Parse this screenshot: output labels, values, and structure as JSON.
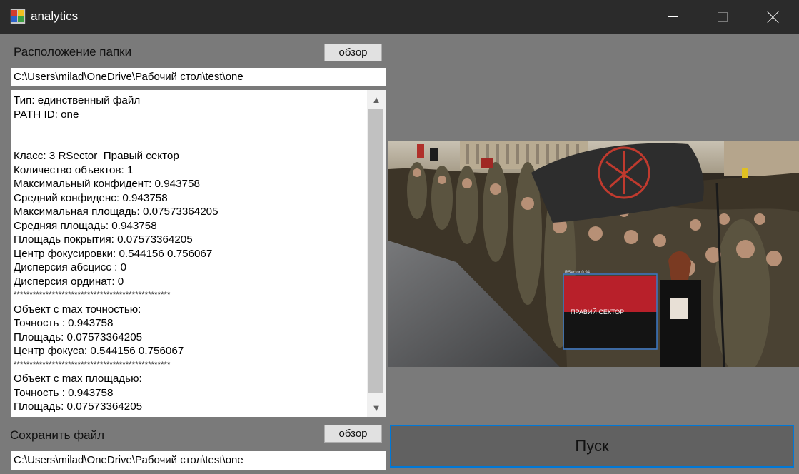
{
  "window": {
    "title": "analytics",
    "icon": "app-icon"
  },
  "controls": {
    "minimize": "minimize-icon",
    "maximize": "maximize-icon",
    "close": "close-icon"
  },
  "folder": {
    "label": "Расположение папки",
    "browse_label": "обзор",
    "path": "C:\\Users\\milad\\OneDrive\\Рабочий стол\\test\\one"
  },
  "log": {
    "lines": [
      "Тип: единственный файл",
      "PATH ID: one",
      "",
      "",
      "Класс: 3 RSector  Правый сектор",
      "Количество объектов: 1",
      "Максимальный конфидент: 0.943758",
      "Средний конфиденс: 0.943758",
      "Максимальная площадь: 0.07573364205",
      "Средняя площадь: 0.943758",
      "Площадь покрытия: 0.07573364205",
      "Центр фокусировки: 0.544156 0.756067",
      "Дисперсия абсцисс : 0",
      "Дисперсия ординат: 0",
      "*************************************************",
      "Объект с max точностью:",
      "Точность : 0.943758",
      "Площадь: 0.07573364205",
      "Центр фокуса: 0.544156 0.756067",
      "*************************************************",
      "Объект с max площадью:",
      "Точность : 0.943758",
      "Площадь: 0.07573364205"
    ]
  },
  "save": {
    "label": "Сохранить файл",
    "browse_label": "обзор",
    "path": "C:\\Users\\milad\\OneDrive\\Рабочий стол\\test\\one"
  },
  "run_label": "Пуск",
  "preview": {
    "detection_label": "RSector 0.94",
    "flag_text": "ПРАВИЙ СЕКТОР",
    "box_color": "#3a78c8"
  },
  "colors": {
    "accent": "#0078d7",
    "background": "#7a7a7a",
    "titlebar": "#2b2b2b"
  }
}
